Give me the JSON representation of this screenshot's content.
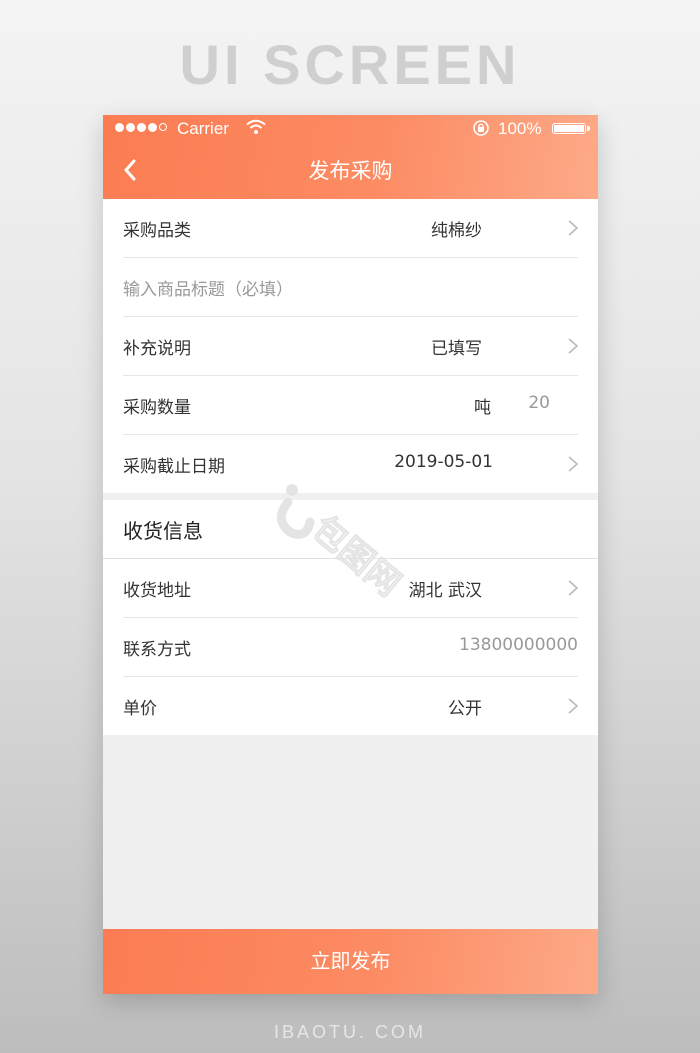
{
  "banner": {
    "title": "UI SCREEN",
    "site": "IBAOTU. COM"
  },
  "status_bar": {
    "carrier": "Carrier",
    "battery": "100%"
  },
  "nav": {
    "title": "发布采购"
  },
  "form": {
    "category": {
      "label": "采购品类",
      "value": "纯棉纱"
    },
    "title_input": {
      "placeholder": "输入商品标题（必填）"
    },
    "supplement": {
      "label": "补充说明",
      "value": "已填写"
    },
    "quantity": {
      "label": "采购数量",
      "unit": "吨",
      "value": "20"
    },
    "deadline": {
      "label": "采购截止日期",
      "value": "2019-05-01"
    }
  },
  "delivery": {
    "heading": "收货信息",
    "address": {
      "label": "收货地址",
      "value": "湖北 武汉"
    },
    "contact": {
      "label": "联系方式",
      "value": "13800000000"
    },
    "price": {
      "label": "单价",
      "value": "公开"
    }
  },
  "submit_label": "立即发布",
  "watermark": {
    "text": "包图网"
  },
  "colors": {
    "accent": "#fb7c52",
    "accent_light": "#fdaa88"
  }
}
